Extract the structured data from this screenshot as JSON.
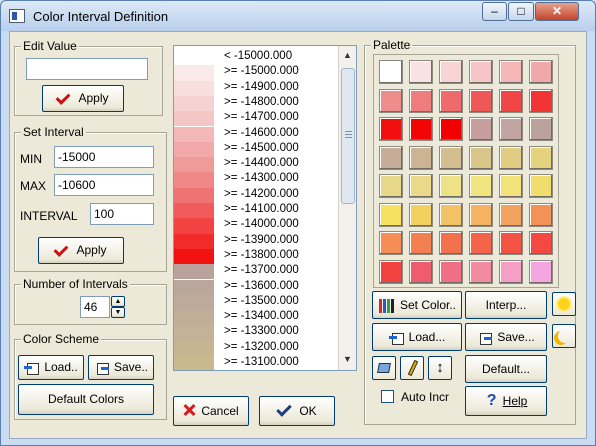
{
  "window": {
    "title": "Color Interval Definition"
  },
  "edit_value": {
    "label": "Edit Value",
    "value": "",
    "apply_label": "Apply"
  },
  "set_interval": {
    "label": "Set Interval",
    "min_label": "MIN",
    "min_value": "-15000",
    "max_label": "MAX",
    "max_value": "-10600",
    "interval_label": "INTERVAL",
    "interval_value": "100",
    "apply_label": "Apply"
  },
  "num_intervals": {
    "label": "Number of Intervals",
    "value": "46"
  },
  "color_scheme": {
    "label": "Color Scheme",
    "load_label": "Load..",
    "save_label": "Save..",
    "default_label": "Default Colors"
  },
  "list": {
    "rows": [
      {
        "text": "<  -15000.000",
        "color": "#ffffff"
      },
      {
        "text": ">= -15000.000",
        "color": "#fbeaea"
      },
      {
        "text": ">= -14900.000",
        "color": "#f9dede"
      },
      {
        "text": ">= -14800.000",
        "color": "#f7d2d2"
      },
      {
        "text": ">= -14700.000",
        "color": "#f5c6c6"
      },
      {
        "text": ">= -14600.000",
        "color": "#f3b8b8"
      },
      {
        "text": ">= -14500.000",
        "color": "#f2a9a9"
      },
      {
        "text": ">= -14400.000",
        "color": "#f09a9a"
      },
      {
        "text": ">= -14300.000",
        "color": "#f08888"
      },
      {
        "text": ">= -14200.000",
        "color": "#f07373"
      },
      {
        "text": ">= -14100.000",
        "color": "#f15b5b"
      },
      {
        "text": ">= -14000.000",
        "color": "#f24242"
      },
      {
        "text": ">= -13900.000",
        "color": "#f22a2a"
      },
      {
        "text": ">= -13800.000",
        "color": "#f31212"
      },
      {
        "text": ">= -13700.000",
        "color": "#b9a29c"
      },
      {
        "text": ">= -13600.000",
        "color": "#bba69b"
      },
      {
        "text": ">= -13500.000",
        "color": "#bea99a"
      },
      {
        "text": ">= -13400.000",
        "color": "#c2ad98"
      },
      {
        "text": ">= -13300.000",
        "color": "#c4b196"
      },
      {
        "text": ">= -13200.000",
        "color": "#c7b592"
      },
      {
        "text": ">= -13100.000",
        "color": "#c9b98f"
      }
    ]
  },
  "palette": {
    "label": "Palette",
    "colors": [
      [
        "#ffffff",
        "#fbe2e2",
        "#f9d4d4",
        "#f6c5c5",
        "#f4b6b6",
        "#f1a8a8"
      ],
      [
        "#ef8c8c",
        "#ef7d7d",
        "#ef6a6a",
        "#f05858",
        "#f04646",
        "#f23434"
      ],
      [
        "#f20f0f",
        "#f20505",
        "#f20000",
        "#c79e9e",
        "#c2a5a2",
        "#bba39c"
      ],
      [
        "#c6ad98",
        "#ccb493",
        "#d4bd8e",
        "#dac688",
        "#e0cc83",
        "#e5d27c"
      ],
      [
        "#e8d98a",
        "#ebd98a",
        "#ede286",
        "#f0e57f",
        "#f2e27a",
        "#f1dd6e"
      ],
      [
        "#f6e160",
        "#f3d060",
        "#f3c264",
        "#f4b362",
        "#f3a25f",
        "#f39256"
      ],
      [
        "#f58e55",
        "#f48051",
        "#f3724d",
        "#f36448",
        "#f25343",
        "#f34941"
      ],
      [
        "#f2443f",
        "#ef5c6e",
        "#ef6f86",
        "#f28aa2",
        "#f59fc4",
        "#f3a6df"
      ]
    ]
  },
  "palette_buttons": {
    "set_color": "Set Color..",
    "interp": "Interp...",
    "load": "Load...",
    "save": "Save...",
    "default": "Default...",
    "auto_incr": "Auto Incr",
    "help": "Help"
  },
  "footer": {
    "cancel": "Cancel",
    "ok": "OK"
  },
  "icons": {
    "sun": "sun-icon",
    "moon": "moon-icon",
    "paint": "paint-bucket-icon",
    "eyedrop": "eyedropper-icon",
    "swap": "swap-vertical-icon",
    "help": "help-icon"
  }
}
